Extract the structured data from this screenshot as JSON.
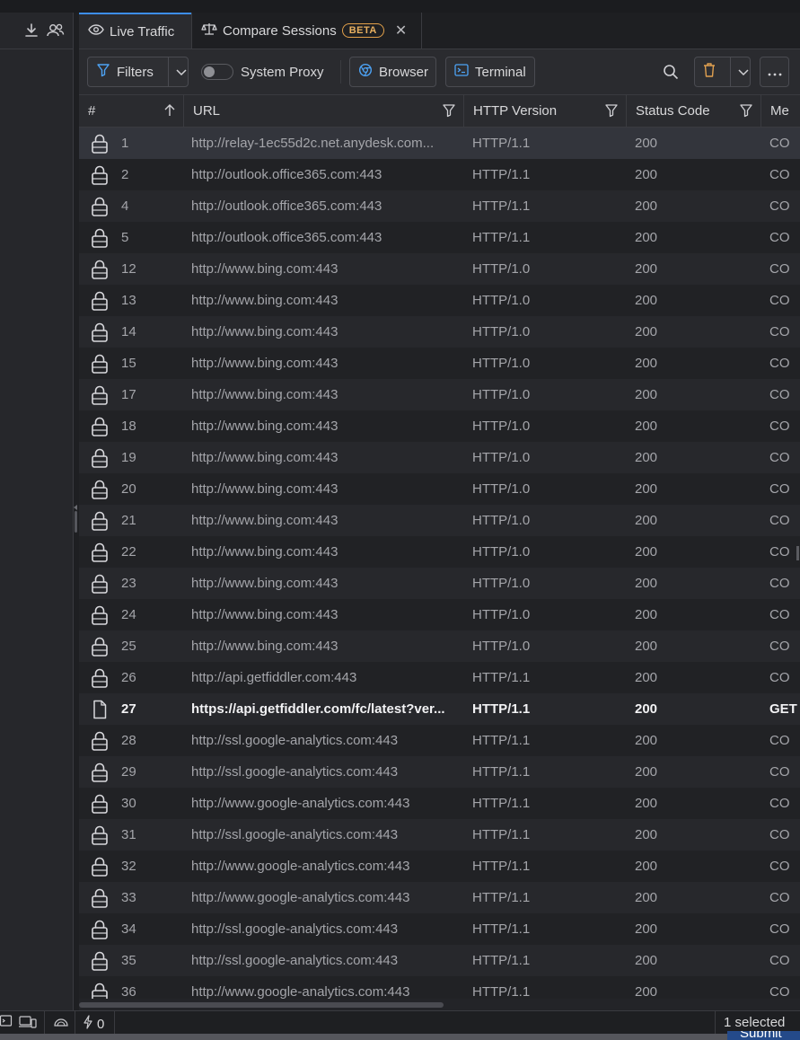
{
  "tabs": [
    {
      "label": "Live Traffic",
      "icon": "eye-icon",
      "active": true
    },
    {
      "label": "Compare Sessions",
      "icon": "scale-icon",
      "badge": "BETA",
      "active": false
    }
  ],
  "toolbar": {
    "filters_label": "Filters",
    "system_proxy_label": "System Proxy",
    "browser_label": "Browser",
    "terminal_label": "Terminal"
  },
  "columns": [
    {
      "key": "num",
      "label": "#"
    },
    {
      "key": "url",
      "label": "URL"
    },
    {
      "key": "version",
      "label": "HTTP Version"
    },
    {
      "key": "status",
      "label": "Status Code"
    },
    {
      "key": "method",
      "label": "Me"
    }
  ],
  "rows": [
    {
      "num": "1",
      "url": "http://relay-1ec55d2c.net.anydesk.com...",
      "version": "HTTP/1.1",
      "status": "200",
      "method": "CO",
      "icon": "lock-icon",
      "selected": true,
      "bold": false
    },
    {
      "num": "2",
      "url": "http://outlook.office365.com:443",
      "version": "HTTP/1.1",
      "status": "200",
      "method": "CO",
      "icon": "lock-icon",
      "selected": false,
      "bold": false
    },
    {
      "num": "4",
      "url": "http://outlook.office365.com:443",
      "version": "HTTP/1.1",
      "status": "200",
      "method": "CO",
      "icon": "lock-icon",
      "selected": false,
      "bold": false
    },
    {
      "num": "5",
      "url": "http://outlook.office365.com:443",
      "version": "HTTP/1.1",
      "status": "200",
      "method": "CO",
      "icon": "lock-icon",
      "selected": false,
      "bold": false
    },
    {
      "num": "12",
      "url": "http://www.bing.com:443",
      "version": "HTTP/1.0",
      "status": "200",
      "method": "CO",
      "icon": "lock-icon",
      "selected": false,
      "bold": false
    },
    {
      "num": "13",
      "url": "http://www.bing.com:443",
      "version": "HTTP/1.0",
      "status": "200",
      "method": "CO",
      "icon": "lock-icon",
      "selected": false,
      "bold": false
    },
    {
      "num": "14",
      "url": "http://www.bing.com:443",
      "version": "HTTP/1.0",
      "status": "200",
      "method": "CO",
      "icon": "lock-icon",
      "selected": false,
      "bold": false
    },
    {
      "num": "15",
      "url": "http://www.bing.com:443",
      "version": "HTTP/1.0",
      "status": "200",
      "method": "CO",
      "icon": "lock-icon",
      "selected": false,
      "bold": false
    },
    {
      "num": "17",
      "url": "http://www.bing.com:443",
      "version": "HTTP/1.0",
      "status": "200",
      "method": "CO",
      "icon": "lock-icon",
      "selected": false,
      "bold": false
    },
    {
      "num": "18",
      "url": "http://www.bing.com:443",
      "version": "HTTP/1.0",
      "status": "200",
      "method": "CO",
      "icon": "lock-icon",
      "selected": false,
      "bold": false
    },
    {
      "num": "19",
      "url": "http://www.bing.com:443",
      "version": "HTTP/1.0",
      "status": "200",
      "method": "CO",
      "icon": "lock-icon",
      "selected": false,
      "bold": false
    },
    {
      "num": "20",
      "url": "http://www.bing.com:443",
      "version": "HTTP/1.0",
      "status": "200",
      "method": "CO",
      "icon": "lock-icon",
      "selected": false,
      "bold": false
    },
    {
      "num": "21",
      "url": "http://www.bing.com:443",
      "version": "HTTP/1.0",
      "status": "200",
      "method": "CO",
      "icon": "lock-icon",
      "selected": false,
      "bold": false
    },
    {
      "num": "22",
      "url": "http://www.bing.com:443",
      "version": "HTTP/1.0",
      "status": "200",
      "method": "CO",
      "icon": "lock-icon",
      "selected": false,
      "bold": false
    },
    {
      "num": "23",
      "url": "http://www.bing.com:443",
      "version": "HTTP/1.0",
      "status": "200",
      "method": "CO",
      "icon": "lock-icon",
      "selected": false,
      "bold": false
    },
    {
      "num": "24",
      "url": "http://www.bing.com:443",
      "version": "HTTP/1.0",
      "status": "200",
      "method": "CO",
      "icon": "lock-icon",
      "selected": false,
      "bold": false
    },
    {
      "num": "25",
      "url": "http://www.bing.com:443",
      "version": "HTTP/1.0",
      "status": "200",
      "method": "CO",
      "icon": "lock-icon",
      "selected": false,
      "bold": false
    },
    {
      "num": "26",
      "url": "http://api.getfiddler.com:443",
      "version": "HTTP/1.1",
      "status": "200",
      "method": "CO",
      "icon": "lock-icon",
      "selected": false,
      "bold": false
    },
    {
      "num": "27",
      "url": "https://api.getfiddler.com/fc/latest?ver...",
      "version": "HTTP/1.1",
      "status": "200",
      "method": "GET",
      "icon": "document-icon",
      "selected": false,
      "bold": true
    },
    {
      "num": "28",
      "url": "http://ssl.google-analytics.com:443",
      "version": "HTTP/1.1",
      "status": "200",
      "method": "CO",
      "icon": "lock-icon",
      "selected": false,
      "bold": false
    },
    {
      "num": "29",
      "url": "http://ssl.google-analytics.com:443",
      "version": "HTTP/1.1",
      "status": "200",
      "method": "CO",
      "icon": "lock-icon",
      "selected": false,
      "bold": false
    },
    {
      "num": "30",
      "url": "http://www.google-analytics.com:443",
      "version": "HTTP/1.1",
      "status": "200",
      "method": "CO",
      "icon": "lock-icon",
      "selected": false,
      "bold": false
    },
    {
      "num": "31",
      "url": "http://ssl.google-analytics.com:443",
      "version": "HTTP/1.1",
      "status": "200",
      "method": "CO",
      "icon": "lock-icon",
      "selected": false,
      "bold": false
    },
    {
      "num": "32",
      "url": "http://www.google-analytics.com:443",
      "version": "HTTP/1.1",
      "status": "200",
      "method": "CO",
      "icon": "lock-icon",
      "selected": false,
      "bold": false
    },
    {
      "num": "33",
      "url": "http://www.google-analytics.com:443",
      "version": "HTTP/1.1",
      "status": "200",
      "method": "CO",
      "icon": "lock-icon",
      "selected": false,
      "bold": false
    },
    {
      "num": "34",
      "url": "http://ssl.google-analytics.com:443",
      "version": "HTTP/1.1",
      "status": "200",
      "method": "CO",
      "icon": "lock-icon",
      "selected": false,
      "bold": false
    },
    {
      "num": "35",
      "url": "http://ssl.google-analytics.com:443",
      "version": "HTTP/1.1",
      "status": "200",
      "method": "CO",
      "icon": "lock-icon",
      "selected": false,
      "bold": false
    },
    {
      "num": "36",
      "url": "http://www.google-analytics.com:443",
      "version": "HTTP/1.1",
      "status": "200",
      "method": "CO",
      "icon": "lock-icon",
      "selected": false,
      "bold": false
    }
  ],
  "statusbar": {
    "connections_count": "0",
    "selection_text": "1 selected"
  },
  "overlay": {
    "submit_peek": "Submit"
  },
  "colors": {
    "accent": "#3d8ef0",
    "beta_badge": "#e2a04a",
    "background": "#232428"
  }
}
